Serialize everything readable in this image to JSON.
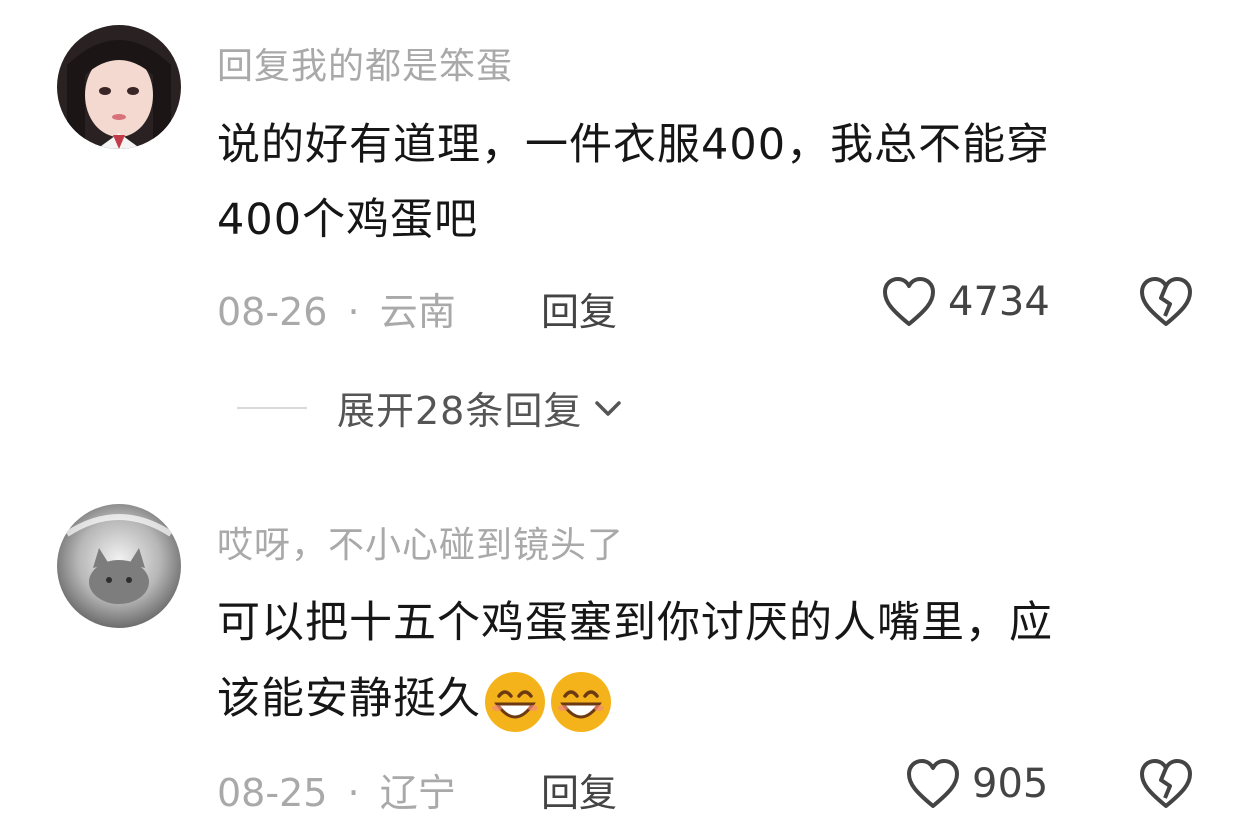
{
  "comments": [
    {
      "username": "回复我的都是笨蛋",
      "text_line1": "说的好有道理，一件衣服400，我总不能穿",
      "text_line2": "400个鸡蛋吧",
      "date": "08-26",
      "location": "云南",
      "separator": "·",
      "reply_label": "回复",
      "likes": "4734",
      "emojis": []
    },
    {
      "username": "哎呀，不小心碰到镜头了",
      "text_line1": "可以把十五个鸡蛋塞到你讨厌的人嘴里，应",
      "text_line2": "该能安静挺久",
      "date": "08-25",
      "location": "辽宁",
      "separator": "·",
      "reply_label": "回复",
      "likes": "905",
      "emojis": [
        "grin-emoji",
        "grin-emoji"
      ]
    }
  ],
  "expand_replies": {
    "label": "展开28条回复",
    "icon": "chevron-down-icon"
  },
  "icons": {
    "like": "heart-outline-icon",
    "dislike": "broken-heart-icon"
  },
  "colors": {
    "muted": "#a9a9a9",
    "text": "#161616",
    "action": "#444444",
    "emoji": "#f5b31b"
  }
}
